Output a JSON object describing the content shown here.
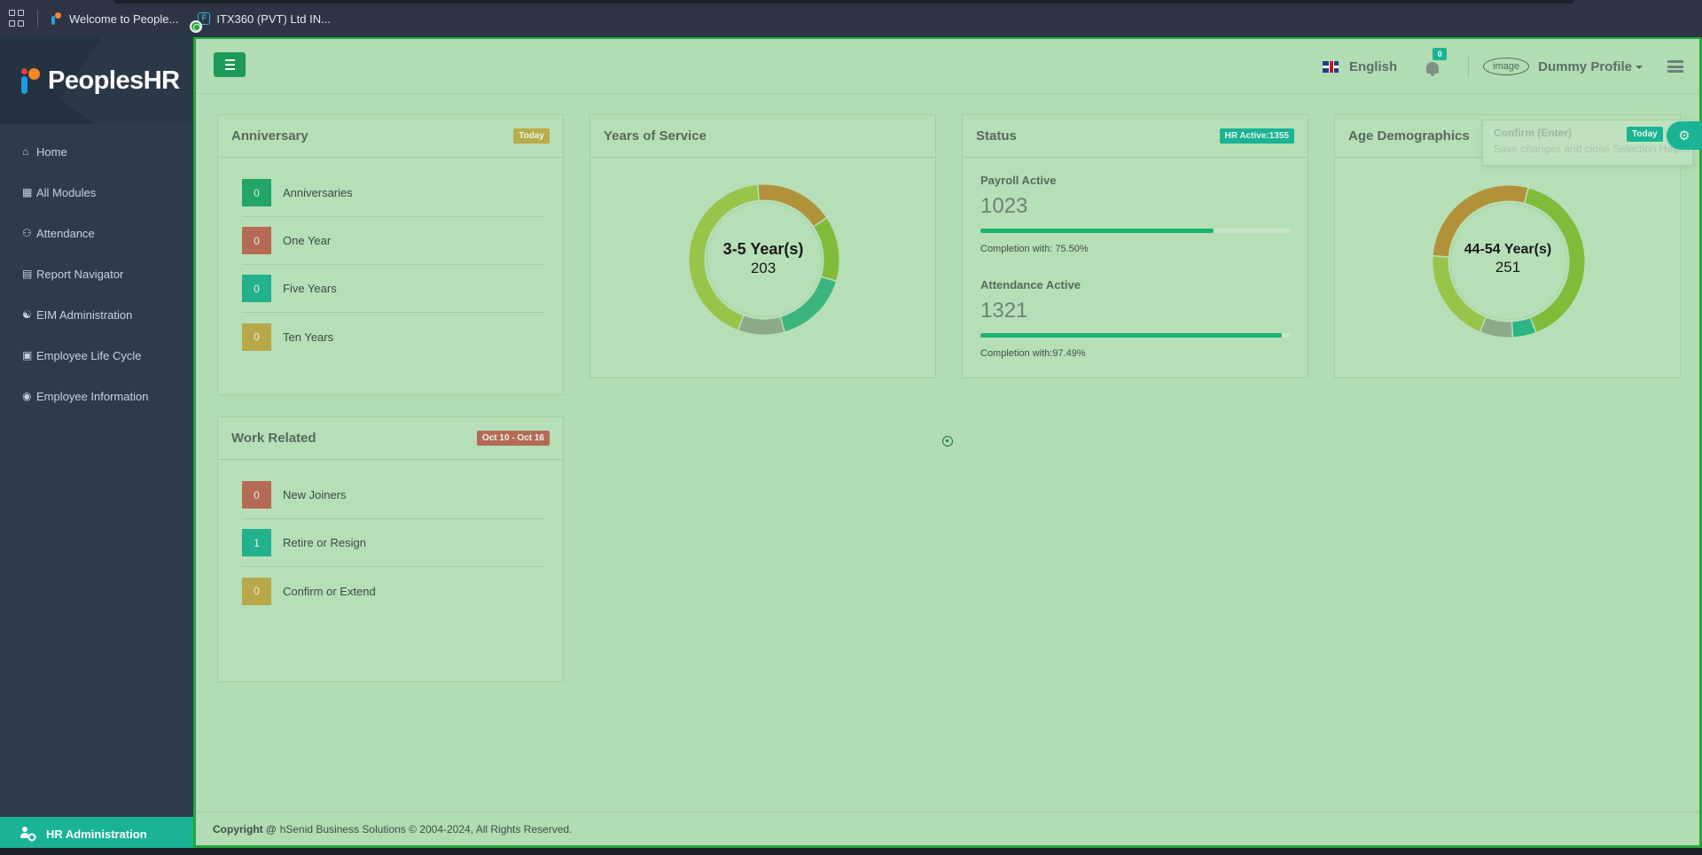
{
  "browser": {
    "bookmarks": [
      {
        "label": "Welcome to People...",
        "icon": "peopleshr-favicon"
      },
      {
        "label": "ITX360 (PVT) Ltd IN...",
        "icon": "itx-favicon"
      }
    ]
  },
  "sidebar": {
    "logo_text": "PeoplesHR",
    "items": [
      {
        "label": "Home",
        "icon": "home-icon"
      },
      {
        "label": "All Modules",
        "icon": "grid-icon"
      },
      {
        "label": "Attendance",
        "icon": "user-clock-icon"
      },
      {
        "label": "Report Navigator",
        "icon": "report-icon"
      },
      {
        "label": "EIM Administration",
        "icon": "users-icon"
      },
      {
        "label": "Employee Life Cycle",
        "icon": "briefcase-icon"
      },
      {
        "label": "Employee Information",
        "icon": "user-circle-icon"
      }
    ],
    "footer_label": "HR Administration"
  },
  "topbar": {
    "language": "English",
    "notification_count": "0",
    "avatar_alt": "image",
    "profile_name": "Dummy Profile"
  },
  "anniversary": {
    "title": "Anniversary",
    "badge": "Today",
    "rows": [
      {
        "count": "0",
        "label": "Anniversaries",
        "color": "#22a567"
      },
      {
        "count": "0",
        "label": "One Year",
        "color": "#b56a55"
      },
      {
        "count": "0",
        "label": "Five Years",
        "color": "#22b08d"
      },
      {
        "count": "0",
        "label": "Ten Years",
        "color": "#b8a84a"
      }
    ]
  },
  "years_of_service": {
    "title": "Years of Service",
    "center_title": "3-5 Year(s)",
    "center_value": "203"
  },
  "status": {
    "title": "Status",
    "badge": "HR Active:1355",
    "payroll_label": "Payroll Active",
    "payroll_value": "1023",
    "payroll_completion": "Completion with: 75.50%",
    "payroll_percent": 75.5,
    "attendance_label": "Attendance Active",
    "attendance_value": "1321",
    "attendance_completion": "Completion with:97.49%",
    "attendance_percent": 97.49
  },
  "age_demographics": {
    "title": "Age Demographics",
    "badge": "Today",
    "center_title": "44-54 Year(s)",
    "center_value": "251"
  },
  "tooltip": {
    "title": "Confirm (Enter)",
    "subtitle": "Save changes and close Selection Helper"
  },
  "work_related": {
    "title": "Work Related",
    "badge": "Oct 10 - Oct 16",
    "rows": [
      {
        "count": "0",
        "label": "New Joiners",
        "color": "#b56a55"
      },
      {
        "count": "1",
        "label": "Retire or Resign",
        "color": "#22b08d"
      },
      {
        "count": "0",
        "label": "Confirm or Extend",
        "color": "#b8a84a"
      }
    ]
  },
  "footer": {
    "copyright_bold": "Copyright @",
    "copyright_text": "hSenid Business Solutions © 2004-2024, All Rights Reserved."
  },
  "colors": {
    "accent": "#1ab394",
    "sidebar_bg": "#2e3b4b",
    "overlay_bg": "#b2dcb2",
    "overlay_border": "#22a83a"
  },
  "chart_data": [
    {
      "type": "pie",
      "title": "Years of Service",
      "segment_colors": [
        "#b1923a",
        "#80bb3a",
        "#3bb57d",
        "#8daa88",
        "#99c44a"
      ],
      "segment_fractions": [
        0.17,
        0.14,
        0.16,
        0.1,
        0.43
      ]
    },
    {
      "type": "pie",
      "title": "Age Demographics",
      "segment_colors": [
        "#80bb3a",
        "#2ab585",
        "#8daa88",
        "#99c44a",
        "#b1923a"
      ],
      "segment_fractions": [
        0.4,
        0.05,
        0.07,
        0.2,
        0.28
      ]
    }
  ]
}
